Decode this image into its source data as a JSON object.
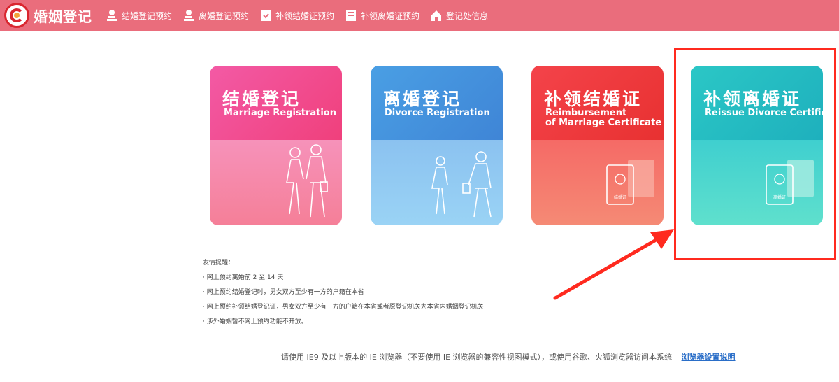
{
  "header": {
    "brand": "婚姻登记",
    "nav": [
      {
        "label": "结婚登记预约",
        "icon": "stamp-icon"
      },
      {
        "label": "离婚登记预约",
        "icon": "stamp-icon"
      },
      {
        "label": "补领结婚证预约",
        "icon": "certificate-icon"
      },
      {
        "label": "补领离婚证预约",
        "icon": "certificate-icon"
      },
      {
        "label": "登记处信息",
        "icon": "house-icon"
      }
    ]
  },
  "cards": [
    {
      "cn": "结婚登记",
      "en": "Marriage Registration",
      "en2": "",
      "art": "couple-icon"
    },
    {
      "cn": "离婚登记",
      "en": "Divorce Registration",
      "en2": "",
      "art": "separated-couple-icon"
    },
    {
      "cn": "补领结婚证",
      "en": "Reimbursement",
      "en2": "of Marriage Certificate",
      "art": "marriage-certificate-icon"
    },
    {
      "cn": "补领离婚证",
      "en": "Reissue Divorce Certificate",
      "en2": "",
      "art": "divorce-certificate-icon"
    }
  ],
  "certificate_labels": {
    "marriage": "结婚证",
    "divorce": "离婚证"
  },
  "notice": {
    "title": "友情提醒：",
    "items": [
      "· 网上预约离婚前 2 至 14 天",
      "· 网上预约结婚登记时，男女双方至少有一方的户籍在本省",
      "· 网上预约补领结婚登记证，男女双方至少有一方的户籍在本省或者原登记机关为本省内婚姻登记机关",
      "· 涉外婚姻暂不网上预约功能不开放。"
    ]
  },
  "footer": {
    "text": "请使用 IE9 及以上版本的 IE 浏览器（不要使用 IE 浏览器的兼容性视图模式），或使用谷歌、火狐浏览器访问本系统",
    "link": "浏览器设置说明"
  },
  "colors": {
    "header": "#ea6d7c",
    "highlight": "#ff2a1f"
  }
}
